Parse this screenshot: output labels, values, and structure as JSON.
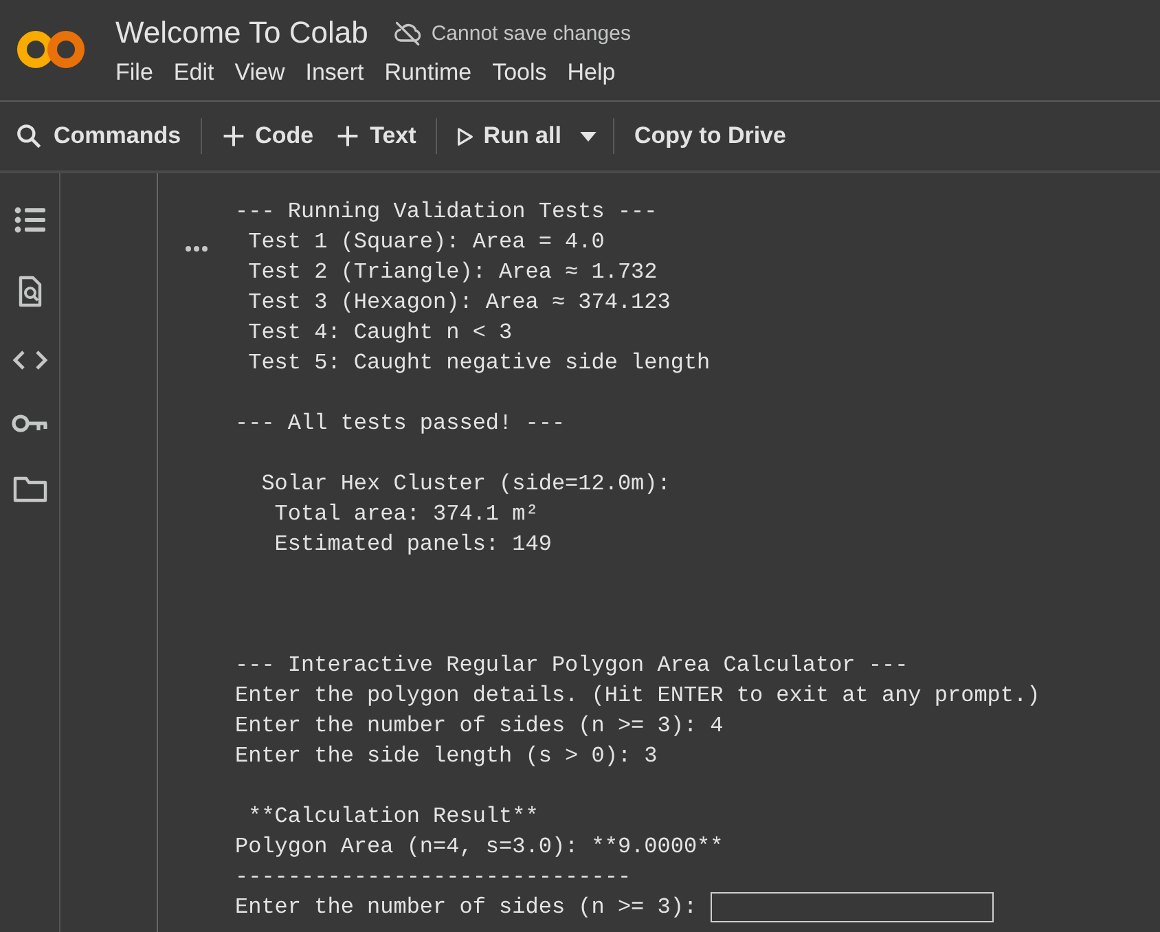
{
  "header": {
    "title": "Welcome To Colab",
    "save_status": "Cannot save changes",
    "menu": [
      "File",
      "Edit",
      "View",
      "Insert",
      "Runtime",
      "Tools",
      "Help"
    ]
  },
  "toolbar": [
    {
      "kind": "search",
      "label": "Commands"
    },
    {
      "kind": "divider"
    },
    {
      "kind": "add",
      "label": "Code"
    },
    {
      "kind": "add",
      "label": "Text"
    },
    {
      "kind": "divider"
    },
    {
      "kind": "run",
      "label": "Run all"
    },
    {
      "kind": "dropdown"
    },
    {
      "kind": "divider"
    },
    {
      "kind": "plain",
      "label": "Copy to Drive"
    }
  ],
  "sidebar": {
    "items": [
      {
        "kind": "toc"
      },
      {
        "kind": "find"
      },
      {
        "kind": "code"
      },
      {
        "kind": "secrets"
      },
      {
        "kind": "files"
      }
    ]
  },
  "output": {
    "blocks": [
      {
        "kind": "tests",
        "lines": [
          "--- Running Validation Tests ---",
          " Test 1 (Square): Area = 4.0",
          " Test 2 (Triangle): Area ≈ 1.732",
          " Test 3 (Hexagon): Area ≈ 374.123",
          " Test 4: Caught n < 3",
          " Test 5: Caught negative side length"
        ]
      },
      {
        "kind": "text",
        "lines": [
          "--- All tests passed! ---"
        ]
      },
      {
        "kind": "text",
        "lines": [
          "  Solar Hex Cluster (side=12.0m):",
          "   Total area: 374.1 m²",
          "   Estimated panels: 149"
        ]
      },
      {
        "kind": "section",
        "lines": [
          "--- Interactive Regular Polygon Area Calculator ---",
          "Enter the polygon details. (Hit ENTER to exit at any prompt.)",
          "Enter the number of sides (n >= 3): 4",
          "Enter the side length (s > 0): 3"
        ]
      },
      {
        "kind": "text",
        "lines": [
          " **Calculation Result**",
          "Polygon Area (n=4, s=3.0): **9.0000**",
          "------------------------------"
        ]
      }
    ],
    "prompt": "Enter the number of sides (n >= 3): "
  }
}
